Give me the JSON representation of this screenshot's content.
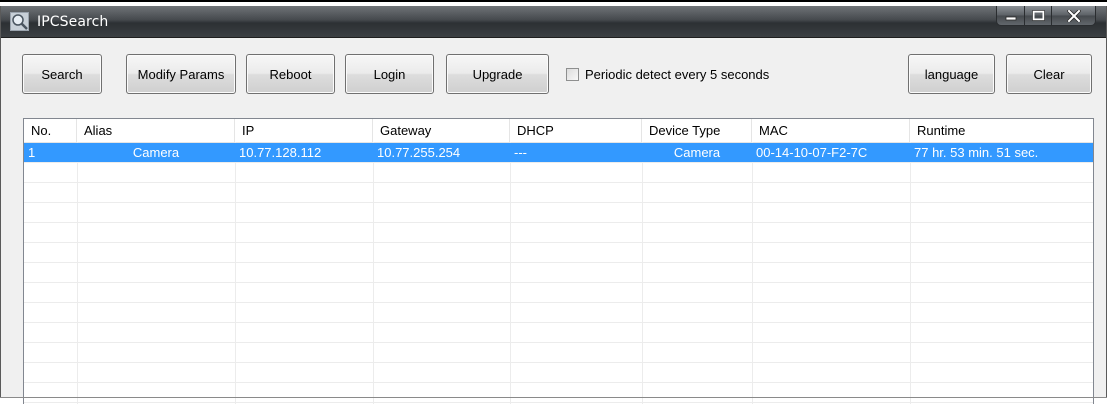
{
  "window": {
    "title": "IPCSearch",
    "controls": {
      "minimize": "minimize-icon",
      "maximize": "maximize-icon",
      "close": "close-icon"
    }
  },
  "toolbar": {
    "search_label": "Search",
    "modify_params_label": "Modify Params",
    "reboot_label": "Reboot",
    "login_label": "Login",
    "upgrade_label": "Upgrade",
    "periodic_detect_label": "Periodic detect every 5 seconds",
    "periodic_detect_checked": false,
    "language_label": "language",
    "clear_label": "Clear"
  },
  "device_list": {
    "columns": [
      "No.",
      "Alias",
      "IP",
      "Gateway",
      "DHCP",
      "Device Type",
      "MAC",
      "Runtime"
    ],
    "rows": [
      {
        "no": "1",
        "alias": "Camera",
        "ip": "10.77.128.112",
        "gateway": "10.77.255.254",
        "dhcp": "---",
        "device_type": "Camera",
        "mac": "00-14-10-07-F2-7C",
        "runtime": "77 hr. 53 min. 51 sec.",
        "selected": true
      }
    ]
  },
  "colors": {
    "selection": "#3399ff",
    "titlebar": "#3b3f43"
  }
}
